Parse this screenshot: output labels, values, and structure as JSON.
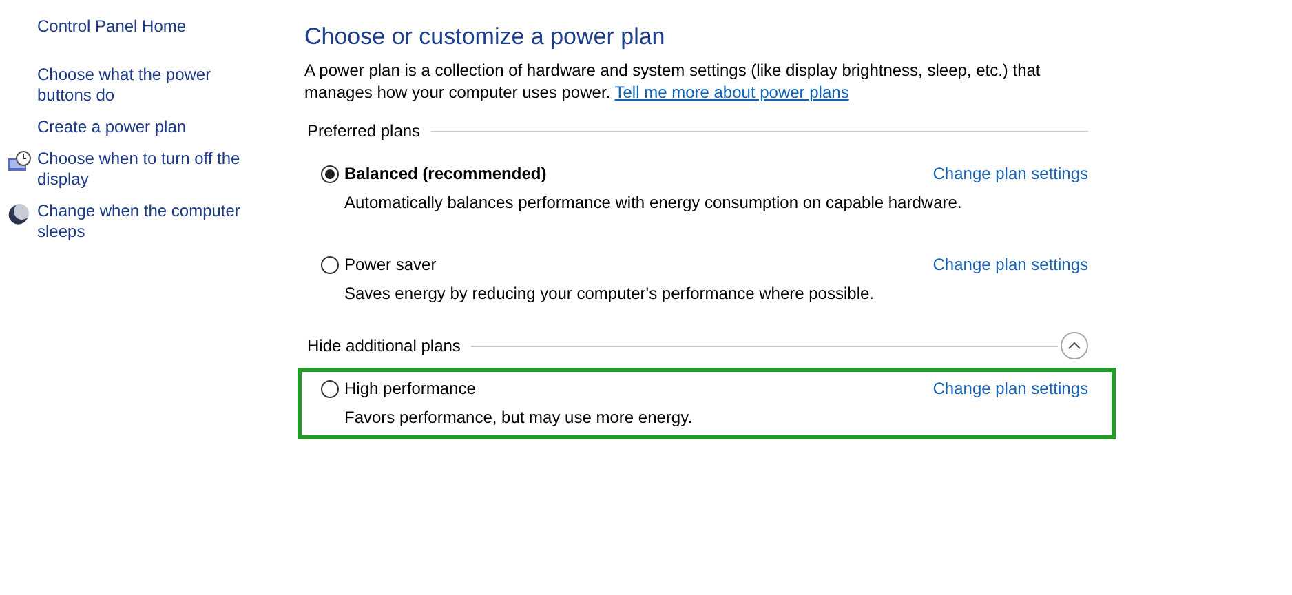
{
  "sidebar": {
    "items": [
      {
        "label": "Control Panel Home",
        "kind": "home"
      },
      {
        "label": "Choose what the power buttons do",
        "kind": "link"
      },
      {
        "label": "Create a power plan",
        "kind": "link"
      },
      {
        "label": "Choose when to turn off the display",
        "kind": "display"
      },
      {
        "label": "Change when the computer sleeps",
        "kind": "sleep"
      }
    ]
  },
  "main": {
    "title": "Choose or customize a power plan",
    "description": "A power plan is a collection of hardware and system settings (like display brightness, sleep, etc.) that manages how your computer uses power.",
    "learn_more_link": "Tell me more about power plans",
    "groups": [
      {
        "heading": "Preferred plans",
        "toggle": false,
        "plans": [
          {
            "name": "Balanced (recommended)",
            "description": "Automatically balances performance with energy consumption on capable hardware.",
            "selected": true,
            "highlighted": false,
            "settings_link": "Change plan settings"
          },
          {
            "name": "Power saver",
            "description": "Saves energy by reducing your computer's performance where possible.",
            "selected": false,
            "highlighted": false,
            "settings_link": "Change plan settings"
          }
        ]
      },
      {
        "heading": "Hide additional plans",
        "toggle": true,
        "plans": [
          {
            "name": "High performance",
            "description": "Favors performance, but may use more energy.",
            "selected": false,
            "highlighted": true,
            "settings_link": "Change plan settings"
          }
        ]
      }
    ]
  }
}
